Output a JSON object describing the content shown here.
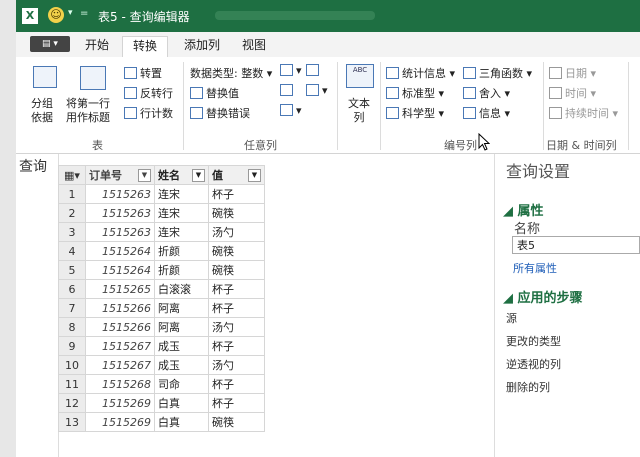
{
  "window": {
    "logo": "X",
    "title": "表5 - 查询编辑器"
  },
  "tabs": [
    {
      "label": "开始"
    },
    {
      "label": "转换"
    },
    {
      "label": "添加列"
    },
    {
      "label": "视图"
    }
  ],
  "ribbon": {
    "table": {
      "group_label": "表",
      "group_by": "分组\n依据",
      "use_first_row": "将第一行\n用作标题",
      "transpose": "转置",
      "reverse_rows": "反转行",
      "count_rows": "行计数"
    },
    "any_column": {
      "group_label": "任意列",
      "data_type": "数据类型: 整数",
      "replace_values": "替换值",
      "replace_errors": "替换错误"
    },
    "text_column": {
      "label": "文本\n列",
      "icon_text": "ABC"
    },
    "number_column": {
      "group_label": "编号列",
      "statistics": "统计信息",
      "standard": "标准型",
      "scientific": "科学型",
      "trigonometry": "三角函数",
      "rounding": "舍入",
      "information": "信息"
    },
    "datetime": {
      "group_label": "日期 & 时间列",
      "date": "日期",
      "time": "时间",
      "duration": "持续时间"
    }
  },
  "left_pane": {
    "label": "查询"
  },
  "grid": {
    "columns": [
      "订单号",
      "姓名",
      "值"
    ],
    "rows": [
      {
        "n": "1",
        "id": "1515263",
        "name": "连宋",
        "val": "杯子"
      },
      {
        "n": "2",
        "id": "1515263",
        "name": "连宋",
        "val": "碗筷"
      },
      {
        "n": "3",
        "id": "1515263",
        "name": "连宋",
        "val": "汤勺"
      },
      {
        "n": "4",
        "id": "1515264",
        "name": "折颜",
        "val": "碗筷"
      },
      {
        "n": "5",
        "id": "1515264",
        "name": "折颜",
        "val": "碗筷"
      },
      {
        "n": "6",
        "id": "1515265",
        "name": "白滚滚",
        "val": "杯子"
      },
      {
        "n": "7",
        "id": "1515266",
        "name": "阿离",
        "val": "杯子"
      },
      {
        "n": "8",
        "id": "1515266",
        "name": "阿离",
        "val": "汤勺"
      },
      {
        "n": "9",
        "id": "1515267",
        "name": "成玉",
        "val": "杯子"
      },
      {
        "n": "10",
        "id": "1515267",
        "name": "成玉",
        "val": "汤勺"
      },
      {
        "n": "11",
        "id": "1515268",
        "name": "司命",
        "val": "杯子"
      },
      {
        "n": "12",
        "id": "1515269",
        "name": "白真",
        "val": "杯子"
      },
      {
        "n": "13",
        "id": "1515269",
        "name": "白真",
        "val": "碗筷"
      }
    ]
  },
  "query_settings": {
    "title": "查询设置",
    "properties_heading": "属性",
    "name_label": "名称",
    "name_value": "表5",
    "all_properties": "所有属性",
    "steps_heading": "应用的步骤",
    "steps": [
      "源",
      "更改的类型",
      "逆透视的列",
      "删除的列"
    ]
  },
  "colors": {
    "excel_green": "#1e6f42",
    "link_blue": "#1f5eb8"
  }
}
